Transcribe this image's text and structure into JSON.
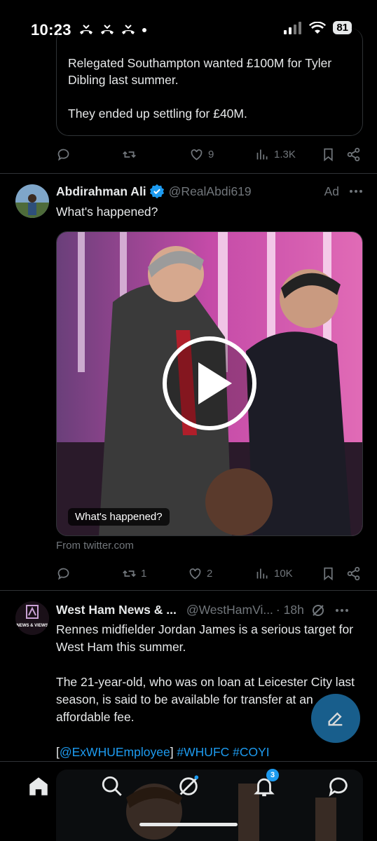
{
  "status_bar": {
    "time": "10:23",
    "battery": "81"
  },
  "quoted_tweet": {
    "line1": "Relegated Southampton wanted £100M for Tyler Dibling last summer.",
    "line2": "They ended up settling for £40M."
  },
  "tweet0_actions": {
    "likes": "9",
    "views": "1.3K"
  },
  "ad_tweet": {
    "name": "Abdirahman Ali",
    "handle": "@RealAbdi619",
    "ad_label": "Ad",
    "text": "What's happened?",
    "video_caption": "What's happened?",
    "source": "From twitter.com",
    "retweets": "1",
    "likes": "2",
    "views": "10K"
  },
  "tweet2": {
    "name": "West Ham News & ...",
    "handle": "@WestHamVi...",
    "time": "· 18h",
    "avatar_text": "NEWS & VIEWS",
    "para1": "Rennes midfielder Jordan James is a serious target for West Ham this summer.",
    "para2": "The 21-year-old, who was on loan at Leicester City last season, is said to be available for transfer at an affordable fee.",
    "mention": "@ExWHUEmployee",
    "hashtag1": "#WHUFC",
    "hashtag2": "#COYI"
  },
  "nav": {
    "notifications_badge": "3"
  },
  "colors": {
    "accent": "#1d9bf0",
    "muted": "#71767b",
    "text": "#e7e9ea",
    "verified": "#1d9bf0"
  }
}
